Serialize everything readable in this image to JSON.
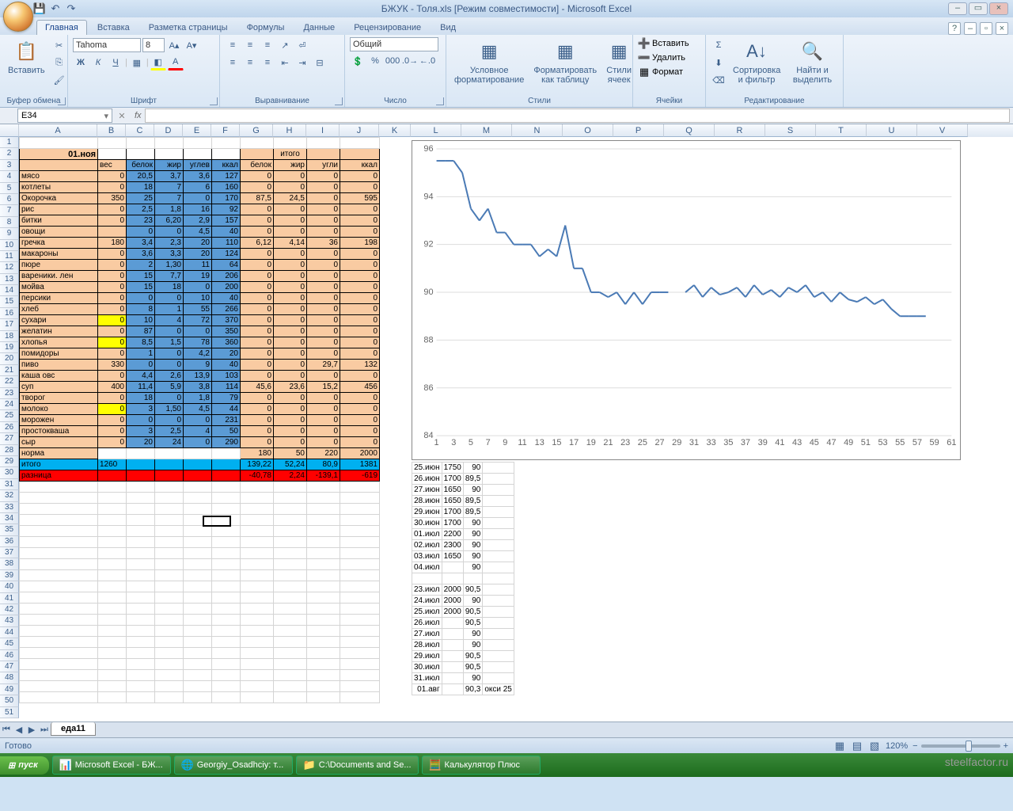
{
  "app": {
    "title": "БЖУК - Толя.xls  [Режим совместимости] - Microsoft Excel"
  },
  "tabs": {
    "items": [
      "Главная",
      "Вставка",
      "Разметка страницы",
      "Формулы",
      "Данные",
      "Рецензирование",
      "Вид"
    ],
    "active": 0
  },
  "ribbon": {
    "clipboard": {
      "label": "Буфер обмена",
      "paste": "Вставить"
    },
    "font": {
      "label": "Шрифт",
      "name": "Tahoma",
      "size": "8"
    },
    "align": {
      "label": "Выравнивание"
    },
    "number": {
      "label": "Число",
      "format": "Общий"
    },
    "styles": {
      "label": "Стили",
      "cond": "Условное форматирование",
      "fmttbl": "Форматировать как таблицу",
      "cell": "Стили ячеек"
    },
    "cells": {
      "label": "Ячейки",
      "insert": "Вставить",
      "delete": "Удалить",
      "format": "Формат"
    },
    "edit": {
      "label": "Редактирование",
      "sort": "Сортировка и фильтр",
      "find": "Найти и выделить"
    }
  },
  "namebox": {
    "cell": "E34"
  },
  "sheet": {
    "date": "01.ноя",
    "cols": [
      "вес",
      "белок",
      "жир",
      "углев",
      "ккал",
      "белок",
      "жир",
      "угли",
      "ккал"
    ],
    "toth": "итого",
    "rows": [
      {
        "n": "мясо",
        "v": [
          "0",
          "20,5",
          "3,7",
          "3,6",
          "127",
          "0",
          "0",
          "0",
          "0"
        ]
      },
      {
        "n": "котлеты",
        "v": [
          "0",
          "18",
          "7",
          "6",
          "160",
          "0",
          "0",
          "0",
          "0"
        ]
      },
      {
        "n": "Окорочка",
        "v": [
          "350",
          "25",
          "7",
          "0",
          "170",
          "87,5",
          "24,5",
          "0",
          "595"
        ]
      },
      {
        "n": "рис",
        "v": [
          "0",
          "2,5",
          "1,8",
          "16",
          "92",
          "0",
          "0",
          "0",
          "0"
        ]
      },
      {
        "n": "битки",
        "v": [
          "0",
          "23",
          "6,20",
          "2,9",
          "157",
          "0",
          "0",
          "0",
          "0"
        ]
      },
      {
        "n": "овощи",
        "v": [
          "",
          "0",
          "0",
          "4,5",
          "40",
          "0",
          "0",
          "0",
          "0"
        ]
      },
      {
        "n": "гречка",
        "v": [
          "180",
          "3,4",
          "2,3",
          "20",
          "110",
          "6,12",
          "4,14",
          "36",
          "198"
        ]
      },
      {
        "n": "макароны",
        "v": [
          "0",
          "3,6",
          "3,3",
          "20",
          "124",
          "0",
          "0",
          "0",
          "0"
        ]
      },
      {
        "n": "пюре",
        "v": [
          "0",
          "2",
          "1,30",
          "11",
          "64",
          "0",
          "0",
          "0",
          "0"
        ]
      },
      {
        "n": "вареники. лен",
        "v": [
          "0",
          "15",
          "7,7",
          "19",
          "206",
          "0",
          "0",
          "0",
          "0"
        ]
      },
      {
        "n": "мойва",
        "v": [
          "0",
          "15",
          "18",
          "0",
          "200",
          "0",
          "0",
          "0",
          "0"
        ]
      },
      {
        "n": "персики",
        "v": [
          "0",
          "0",
          "0",
          "10",
          "40",
          "0",
          "0",
          "0",
          "0"
        ]
      },
      {
        "n": "хлеб",
        "v": [
          "0",
          "8",
          "1",
          "55",
          "266",
          "0",
          "0",
          "0",
          "0"
        ]
      },
      {
        "n": "сухари",
        "v": [
          "0",
          "10",
          "4",
          "72",
          "370",
          "0",
          "0",
          "0",
          "0"
        ],
        "y": true
      },
      {
        "n": "желатин",
        "v": [
          "0",
          "87",
          "0",
          "0",
          "350",
          "0",
          "0",
          "0",
          "0"
        ]
      },
      {
        "n": "хлопья",
        "v": [
          "0",
          "8,5",
          "1,5",
          "78",
          "360",
          "0",
          "0",
          "0",
          "0"
        ],
        "y": true
      },
      {
        "n": "помидоры",
        "v": [
          "0",
          "1",
          "0",
          "4,2",
          "20",
          "0",
          "0",
          "0",
          "0"
        ]
      },
      {
        "n": "пиво",
        "v": [
          "330",
          "0",
          "0",
          "9",
          "40",
          "0",
          "0",
          "29,7",
          "132"
        ]
      },
      {
        "n": "каша овс",
        "v": [
          "0",
          "4,4",
          "2,6",
          "13,9",
          "103",
          "0",
          "0",
          "0",
          "0"
        ]
      },
      {
        "n": "суп",
        "v": [
          "400",
          "11,4",
          "5,9",
          "3,8",
          "114",
          "45,6",
          "23,6",
          "15,2",
          "456"
        ]
      },
      {
        "n": "творог",
        "v": [
          "0",
          "18",
          "0",
          "1,8",
          "79",
          "0",
          "0",
          "0",
          "0"
        ]
      },
      {
        "n": "молоко",
        "v": [
          "0",
          "3",
          "1,50",
          "4,5",
          "44",
          "0",
          "0",
          "0",
          "0"
        ],
        "y": true
      },
      {
        "n": "морожен",
        "v": [
          "0",
          "0",
          "0",
          "0",
          "231",
          "0",
          "0",
          "0",
          "0"
        ]
      },
      {
        "n": "   простокваша",
        "v": [
          "0",
          "3",
          "2,5",
          "4",
          "50",
          "0",
          "0",
          "0",
          "0"
        ]
      },
      {
        "n": "сыр",
        "v": [
          "0",
          "20",
          "24",
          "0",
          "290",
          "0",
          "0",
          "0",
          "0"
        ]
      }
    ],
    "norma": {
      "n": "норма",
      "v": [
        "",
        "",
        "",
        "",
        "",
        "180",
        "50",
        "220",
        "2000"
      ]
    },
    "itogo": {
      "n": "итого",
      "v": [
        "1260",
        "",
        "",
        "",
        "",
        "139,22",
        "52,24",
        "80,9",
        "1381"
      ]
    },
    "razn": {
      "n": "разница",
      "v": [
        "",
        "",
        "",
        "",
        "",
        "-40,78",
        "2,24",
        "-139,1",
        "-619"
      ]
    }
  },
  "side": [
    [
      "25.июн",
      "1750",
      "90"
    ],
    [
      "26.июн",
      "1700",
      "89,5"
    ],
    [
      "27.июн",
      "1650",
      "90"
    ],
    [
      "28.июн",
      "1650",
      "89,5"
    ],
    [
      "29.июн",
      "1700",
      "89,5"
    ],
    [
      "30.июн",
      "1700",
      "90"
    ],
    [
      "01.июл",
      "2200",
      "90"
    ],
    [
      "02.июл",
      "2300",
      "90"
    ],
    [
      "03.июл",
      "1650",
      "90"
    ],
    [
      "04.июл",
      "",
      "90"
    ],
    [
      "",
      "",
      ""
    ],
    [
      "23.июл",
      "2000",
      "90,5"
    ],
    [
      "24.июл",
      "2000",
      "90"
    ],
    [
      "25.июл",
      "2000",
      "90,5"
    ],
    [
      "26.июл",
      "",
      "90,5"
    ],
    [
      "27.июл",
      "",
      "90"
    ],
    [
      "28.июл",
      "",
      "90"
    ],
    [
      "29.июл",
      "",
      "90,5"
    ],
    [
      "30.июл",
      "",
      "90,5"
    ],
    [
      "31.июл",
      "",
      "90"
    ],
    [
      "01.авг",
      "",
      "90,3"
    ]
  ],
  "sidenote": "окси 25",
  "chart_data": {
    "type": "line",
    "x": [
      1,
      3,
      5,
      7,
      9,
      11,
      13,
      15,
      17,
      19,
      21,
      23,
      25,
      27,
      29,
      31,
      33,
      35,
      37,
      39,
      41,
      43,
      45,
      47,
      49,
      51,
      53,
      55,
      57,
      59,
      61
    ],
    "yticks": [
      84,
      86,
      88,
      90,
      92,
      94,
      96
    ],
    "values": [
      95.5,
      95.5,
      95.5,
      95,
      93.5,
      93,
      93.5,
      92.5,
      92.5,
      92,
      92,
      92,
      91.5,
      91.8,
      91.5,
      92.8,
      91,
      91,
      90,
      90,
      89.8,
      90,
      89.5,
      90,
      89.5,
      90,
      90,
      90,
      null,
      90,
      90.3,
      89.8,
      90.2,
      89.9,
      90,
      90.2,
      89.8,
      90.3,
      89.9,
      90.1,
      89.8,
      90.2,
      90,
      90.3,
      89.8,
      90,
      89.6,
      90,
      89.7,
      89.6,
      89.8,
      89.5,
      89.7,
      89.3,
      89,
      89,
      89,
      89
    ]
  },
  "sheettab": "еда11",
  "status": {
    "ready": "Готово",
    "zoom": "120%"
  },
  "taskbar": {
    "start": "пуск",
    "items": [
      "Microsoft Excel - БЖ...",
      "Georgiy_Osadhciy: т...",
      "C:\\Documents and Se...",
      "Калькулятор Плюс"
    ]
  },
  "watermark": "steelfactor.ru"
}
